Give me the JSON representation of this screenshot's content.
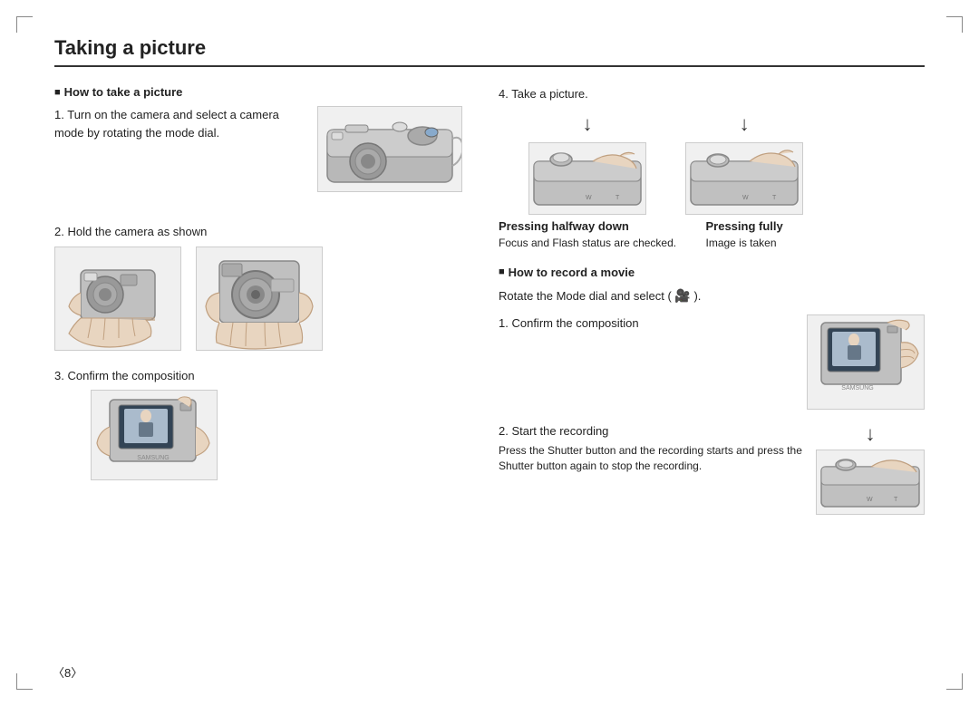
{
  "page": {
    "title": "Taking a picture",
    "page_number": "〈8〉"
  },
  "left_column": {
    "section_header": "How to take a picture",
    "step1": {
      "number": "1.",
      "text": "Turn on the camera and select a camera mode by rotating the mode dial."
    },
    "step2": {
      "number": "2.",
      "text": "Hold the camera as shown"
    },
    "step3": {
      "number": "3.",
      "text": "Confirm the composition"
    }
  },
  "right_column": {
    "step4": {
      "number": "4.",
      "text": "Take a picture."
    },
    "pressing_halfway": {
      "label": "Pressing halfway down",
      "desc": "Focus and Flash status are checked."
    },
    "pressing_fully": {
      "label": "Pressing fully",
      "desc": "Image is taken"
    },
    "movie_section": {
      "header": "How to record a movie",
      "rotate_text": "Rotate the Mode dial and select (",
      "icon": "🎥",
      "icon_end": ").",
      "step1": {
        "number": "1.",
        "text": "Confirm the composition"
      },
      "step2": {
        "number": "2.",
        "text": "Start the recording",
        "desc": "Press the Shutter button and the recording starts and press the Shutter button again to stop the recording."
      }
    }
  }
}
